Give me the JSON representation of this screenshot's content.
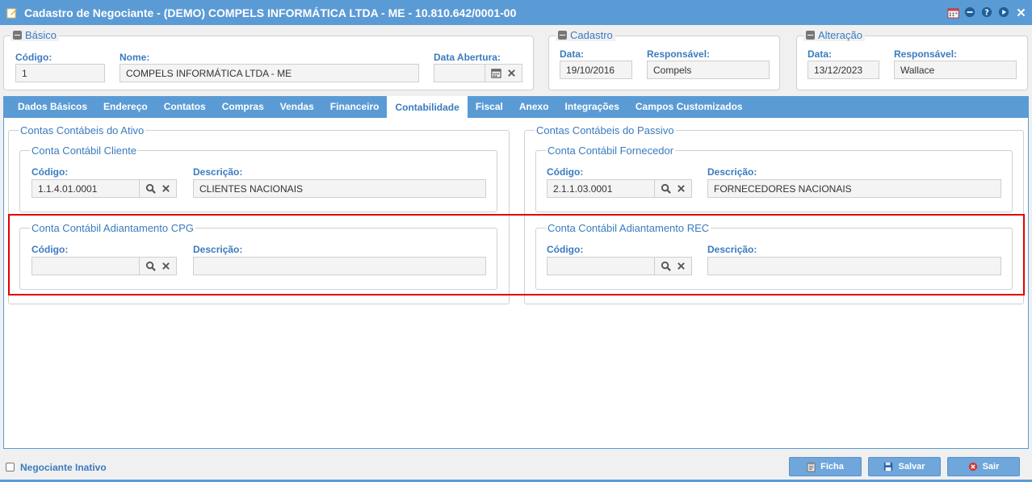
{
  "window": {
    "title": "Cadastro de Negociante - (DEMO) COMPELS INFORMÁTICA LTDA - ME - 10.810.642/0001-00"
  },
  "basico": {
    "legend": "Básico",
    "codigo_label": "Código:",
    "codigo_value": "1",
    "nome_label": "Nome:",
    "nome_value": "COMPELS INFORMÁTICA LTDA - ME",
    "data_abertura_label": "Data Abertura:",
    "data_abertura_value": ""
  },
  "cadastro": {
    "legend": "Cadastro",
    "data_label": "Data:",
    "data_value": "19/10/2016",
    "responsavel_label": "Responsável:",
    "responsavel_value": "Compels"
  },
  "alteracao": {
    "legend": "Alteração",
    "data_label": "Data:",
    "data_value": "13/12/2023",
    "responsavel_label": "Responsável:",
    "responsavel_value": "Wallace"
  },
  "tabs": [
    {
      "label": "Dados Básicos"
    },
    {
      "label": "Endereço"
    },
    {
      "label": "Contatos"
    },
    {
      "label": "Compras"
    },
    {
      "label": "Vendas"
    },
    {
      "label": "Financeiro"
    },
    {
      "label": "Contabilidade",
      "active": true
    },
    {
      "label": "Fiscal"
    },
    {
      "label": "Anexo"
    },
    {
      "label": "Integrações"
    },
    {
      "label": "Campos Customizados"
    }
  ],
  "ativo": {
    "legend": "Contas Contábeis do Ativo",
    "cliente": {
      "legend": "Conta Contábil Cliente",
      "codigo_label": "Código:",
      "codigo_value": "1.1.4.01.0001",
      "descricao_label": "Descrição:",
      "descricao_value": "CLIENTES NACIONAIS"
    },
    "adiantamento": {
      "legend": "Conta Contábil Adiantamento CPG",
      "codigo_label": "Código:",
      "codigo_value": "",
      "descricao_label": "Descrição:",
      "descricao_value": ""
    }
  },
  "passivo": {
    "legend": "Contas Contábeis do Passivo",
    "fornecedor": {
      "legend": "Conta Contábil Fornecedor",
      "codigo_label": "Código:",
      "codigo_value": "2.1.1.03.0001",
      "descricao_label": "Descrição:",
      "descricao_value": "FORNECEDORES NACIONAIS"
    },
    "adiantamento": {
      "legend": "Conta Contábil Adiantamento REC",
      "codigo_label": "Código:",
      "codigo_value": "",
      "descricao_label": "Descrição:",
      "descricao_value": ""
    }
  },
  "footer": {
    "inativo_label": "Negociante Inativo",
    "ficha_label": "Ficha",
    "salvar_label": "Salvar",
    "sair_label": "Sair"
  },
  "colors": {
    "accent": "#5b9bd5",
    "label": "#3a7bbf",
    "highlight": "#e00000"
  }
}
